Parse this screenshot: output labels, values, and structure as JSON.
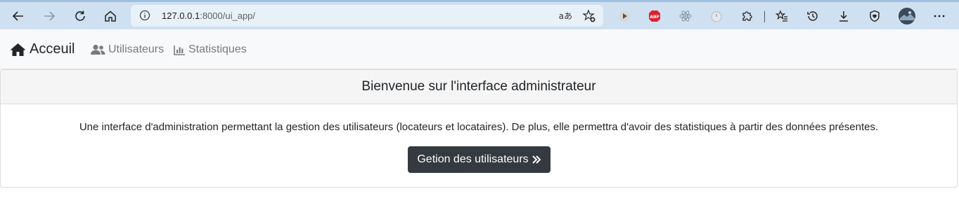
{
  "browser": {
    "url_host": "127.0.0.1",
    "url_rest": ":8000/ui_app/",
    "translate_label": "aあ",
    "extensions": [
      "play-extension-icon",
      "adblock-plus-icon",
      "react-devtools-icon",
      "timer-extension-icon",
      "extensions-puzzle-icon"
    ],
    "adblock_label": "ABP"
  },
  "navbar": {
    "brand_label": "Acceuil",
    "users_label": "Utilisateurs",
    "stats_label": "Statistiques"
  },
  "card": {
    "title": "Bienvenue sur l'interface administrateur",
    "description": "Une interface d'administration permettant la gestion des utilisateurs (locateurs et locataires). De plus, elle permettra d'avoir des statistiques à partir des données présentes.",
    "button_label": "Getion des utilisateurs"
  },
  "colors": {
    "toolbar_bg": "#cfe0f0",
    "navbar_bg": "#f8f9fa",
    "button_bg": "#343a40"
  }
}
